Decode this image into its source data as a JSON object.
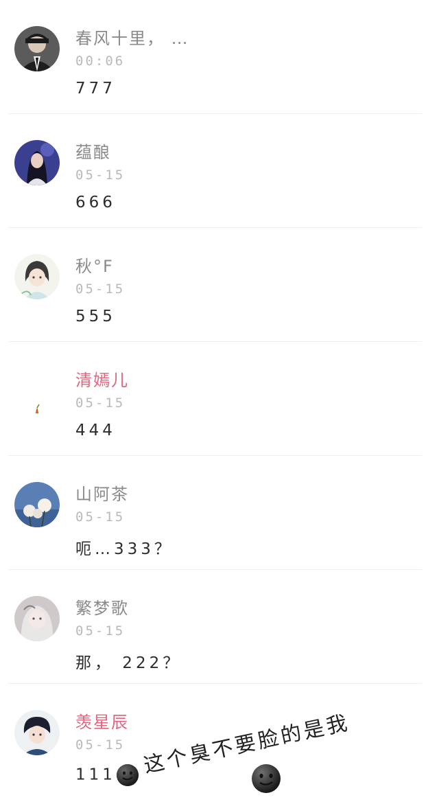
{
  "comments": [
    {
      "name": "春风十里，  …",
      "time": "00:06",
      "text": "777",
      "name_color": "gray"
    },
    {
      "name": "蕴酿",
      "time": "05-15",
      "text": "666",
      "name_color": "gray"
    },
    {
      "name": "秋°F",
      "time": "05-15",
      "text": "555",
      "name_color": "gray"
    },
    {
      "name": "清嫣儿",
      "time": "05-15",
      "text": "444",
      "name_color": "pink"
    },
    {
      "name": "山阿茶",
      "time": "05-15",
      "text": "呃…333？",
      "name_color": "gray"
    },
    {
      "name": "繁梦歌",
      "time": "05-15",
      "text": "那， 222？",
      "name_color": "gray"
    },
    {
      "name": "羡星辰",
      "time": "05-15",
      "text": "111",
      "name_color": "pink"
    }
  ],
  "annotation": "这个臭不要脸的是我",
  "icons": [
    "smirk-emoji-icon",
    "smirk-emoji-icon"
  ],
  "colors": {
    "name_gray": "#8a8a8a",
    "name_pink": "#e2657d",
    "time": "#b9b9b9"
  }
}
